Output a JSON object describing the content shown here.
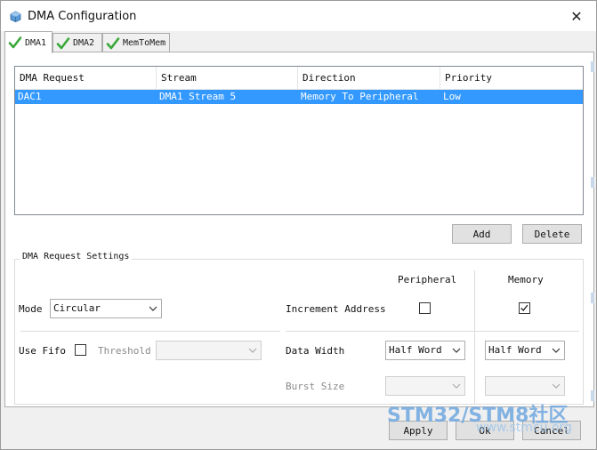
{
  "window": {
    "title": "DMA Configuration"
  },
  "tabs": [
    {
      "label": "DMA1",
      "active": true
    },
    {
      "label": "DMA2",
      "active": false
    },
    {
      "label": "MemToMem",
      "active": false
    }
  ],
  "table": {
    "columns": [
      "DMA Request",
      "Stream",
      "Direction",
      "Priority"
    ],
    "rows": [
      [
        "DAC1",
        "DMA1 Stream 5",
        "Memory To Peripheral",
        "Low"
      ]
    ]
  },
  "actions": {
    "add": "Add",
    "delete": "Delete"
  },
  "settings": {
    "title": "DMA Request Settings",
    "peripheral_header": "Peripheral",
    "memory_header": "Memory",
    "mode_label": "Mode",
    "mode_value": "Circular",
    "increment_label": "Increment Address",
    "peripheral_increment": false,
    "memory_increment": true,
    "use_fifo_label": "Use Fifo",
    "use_fifo": false,
    "threshold_label": "Threshold",
    "threshold_value": "",
    "data_width_label": "Data Width",
    "peripheral_data_width": "Half Word",
    "memory_data_width": "Half Word",
    "burst_size_label": "Burst Size",
    "peripheral_burst": "",
    "memory_burst": ""
  },
  "footer": {
    "apply": "Apply",
    "ok": "Ok",
    "cancel": "Cancel"
  },
  "watermark": {
    "brand": "STM32/STM8社区",
    "site": "www.stmcu.org"
  },
  "colors": {
    "selection": "#3399ff",
    "check": "#3aa83a",
    "watermark": "#6fa8e0"
  }
}
